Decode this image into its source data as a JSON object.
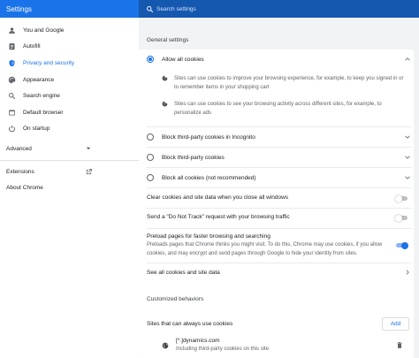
{
  "app": {
    "title": "Settings"
  },
  "search": {
    "placeholder": "Search settings"
  },
  "sidebar": {
    "items": [
      {
        "label": "You and Google",
        "icon": "person-icon"
      },
      {
        "label": "Autofill",
        "icon": "clipboard-icon"
      },
      {
        "label": "Privacy and security",
        "icon": "shield-icon",
        "active": true
      },
      {
        "label": "Appearance",
        "icon": "palette-icon"
      },
      {
        "label": "Search engine",
        "icon": "search-icon"
      },
      {
        "label": "Default browser",
        "icon": "browser-icon"
      },
      {
        "label": "On startup",
        "icon": "power-icon"
      }
    ],
    "advanced": "Advanced",
    "extensions": "Extensions",
    "about": "About Chrome"
  },
  "general": {
    "heading": "General settings",
    "allow_all": "Allow all cookies",
    "allow_all_sub1": "Sites can use cookies to improve your browsing experience, for example, to keep you signed in or to remember items in your shopping cart",
    "allow_all_sub2": "Sites can use cookies to see your browsing activity across different sites, for example, to personalize ads",
    "block_incognito": "Block third-party cookies in Incognito",
    "block_third": "Block third-party cookies",
    "block_all": "Block all cookies (not recommended)",
    "selected_option": "Allow all cookies"
  },
  "toggles": {
    "clear_on_close": {
      "label": "Clear cookies and site data when you close all windows",
      "on": false
    },
    "do_not_track": {
      "label": "Send a \"Do Not Track\" request with your browsing traffic",
      "on": false
    },
    "preload": {
      "label": "Preload pages for faster browsing and searching",
      "desc": "Preloads pages that Chrome thinks you might visit. To do this, Chrome may use cookies, if you allow cookies, and may encrypt and send pages through Google to hide your identity from sites.",
      "on": true
    }
  },
  "see_all": "See all cookies and site data",
  "customized": {
    "heading": "Customized behaviors",
    "always_allow": "Sites that can always use cookies",
    "add_label": "Add",
    "site": {
      "name": "[*.]dynamics.com",
      "desc": "Including third-party cookies on this site"
    }
  },
  "colors": {
    "accent": "#1a73e8",
    "header": "#1a73e8",
    "search_bar": "#1558b0"
  }
}
